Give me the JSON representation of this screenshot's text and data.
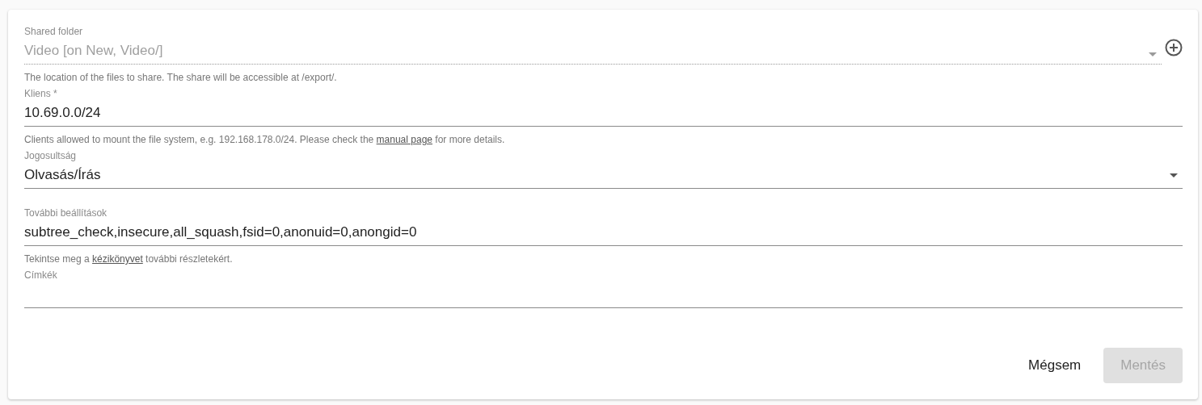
{
  "fields": [
    {
      "kind": "select",
      "label": "Shared folder",
      "value": "Video [on New, Video/]",
      "disabled": true,
      "addable": true,
      "hint": {
        "before": "The location of the files to share. The share will be accessible at /export/."
      }
    },
    {
      "kind": "text",
      "label": "Kliens *",
      "value": "10.69.0.0/24",
      "disabled": false,
      "hint": {
        "before": "Clients allowed to mount the file system, e.g. 192.168.178.0/24. Please check the ",
        "link": "manual page",
        "after": " for more details."
      }
    },
    {
      "kind": "select",
      "label": "Jogosultság",
      "value": "Olvasás/Írás",
      "disabled": false
    },
    {
      "kind": "text",
      "label": "További beállítások",
      "value": "subtree_check,insecure,all_squash,fsid=0,anonuid=0,anongid=0",
      "disabled": false,
      "hint": {
        "before": "Tekintse meg a ",
        "link": "kézikönyvet",
        "after": " további részletekért."
      }
    },
    {
      "kind": "chips",
      "label": "Címkék",
      "disabled": false
    }
  ],
  "buttons": [
    {
      "label": "Mégsem",
      "disabled": false
    },
    {
      "label": "Mentés",
      "disabled": true
    }
  ]
}
